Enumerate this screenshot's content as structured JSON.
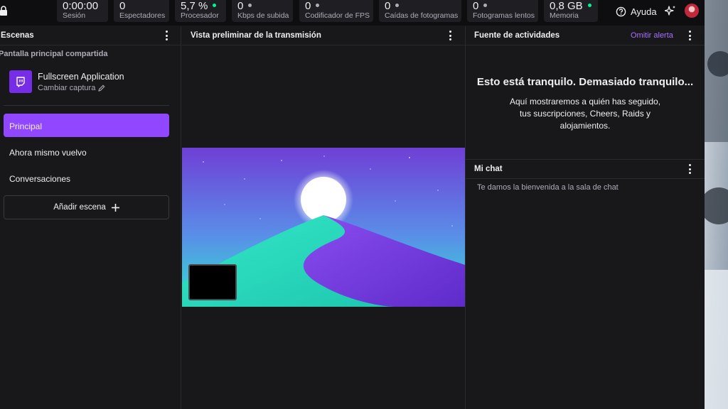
{
  "stats": [
    {
      "value": "0:00:00",
      "label": "Sesión",
      "dot": null
    },
    {
      "value": "0",
      "label": "Espectadores",
      "dot": null
    },
    {
      "value": "5,7 %",
      "label": "Procesador",
      "dot": "#00f593"
    },
    {
      "value": "0",
      "label": "Kbps de subida",
      "dot": "#adadb8"
    },
    {
      "value": "0",
      "label": "Codificador de FPS",
      "dot": "#adadb8"
    },
    {
      "value": "0",
      "label": "Caídas de fotogramas",
      "dot": "#adadb8"
    },
    {
      "value": "0",
      "label": "Fotogramas lentos",
      "dot": "#adadb8"
    },
    {
      "value": "0,8 GB",
      "label": "Memoria",
      "dot": "#00f593"
    }
  ],
  "header": {
    "help_label": "Ayuda"
  },
  "scenes": {
    "title": "Escenas",
    "group_label": "Pantalla principal compartida",
    "source": {
      "name": "Fullscreen Application",
      "action": "Cambiar captura",
      "icon": "twitch-glitch-icon"
    },
    "items": [
      {
        "label": "Principal",
        "active": true
      },
      {
        "label": "Ahora mismo vuelvo",
        "active": false
      },
      {
        "label": "Conversaciones",
        "active": false
      }
    ],
    "add_label": "Añadir escena"
  },
  "preview": {
    "title": "Vista preliminar de la transmisión"
  },
  "activity": {
    "title": "Fuente de actividades",
    "skip_label": "Omitir alerta",
    "empty_title": "Esto está tranquilo. Demasiado tranquilo...",
    "empty_body": "Aquí mostraremos a quién has seguido, tus suscripciones, Cheers, Raids y alojamientos."
  },
  "chat": {
    "title": "Mi chat",
    "welcome": "Te damos la bienvenida a la sala de chat"
  },
  "colors": {
    "accent": "#9147ff",
    "background": "#18181b",
    "topbar": "#0e0e10"
  }
}
